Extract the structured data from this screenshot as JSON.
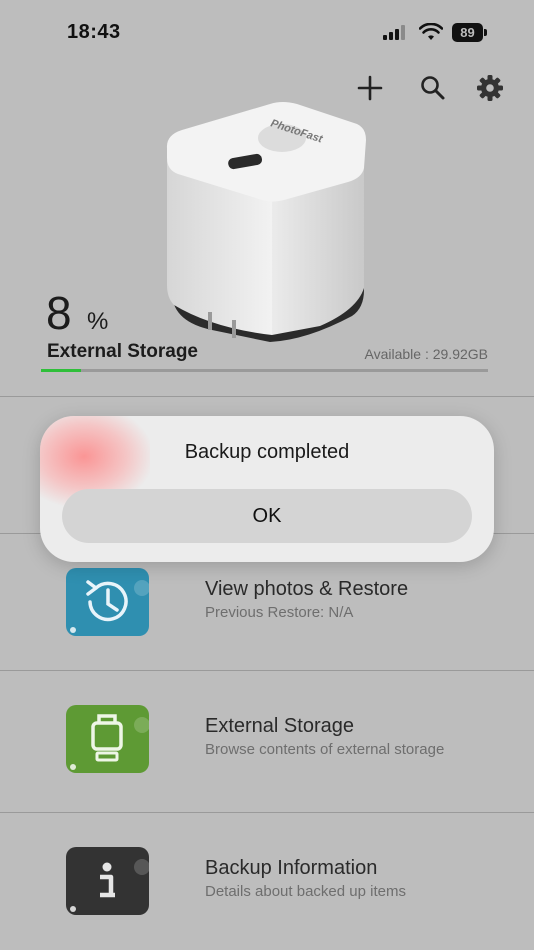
{
  "status_bar": {
    "time": "18:43",
    "battery": "89"
  },
  "storage": {
    "usage_percent": "8",
    "percent_sign": "%",
    "title": "External Storage",
    "available": "Available : 29.92GB",
    "used_fraction": 0.09,
    "accent_color": "#2fbf3a"
  },
  "menu": [
    {
      "title": "View photos & Restore",
      "subtitle": "Previous Restore: N/A",
      "icon": "clock-restore-icon",
      "color": "#2f8fb0"
    },
    {
      "title": "External Storage",
      "subtitle": "Browse contents of external storage",
      "icon": "usb-drive-icon",
      "color": "#5e9a34"
    },
    {
      "title": "Backup Information",
      "subtitle": "Details about backed up items",
      "icon": "info-icon",
      "color": "#333333"
    }
  ],
  "dialog": {
    "message": "Backup completed",
    "ok_label": "OK"
  }
}
